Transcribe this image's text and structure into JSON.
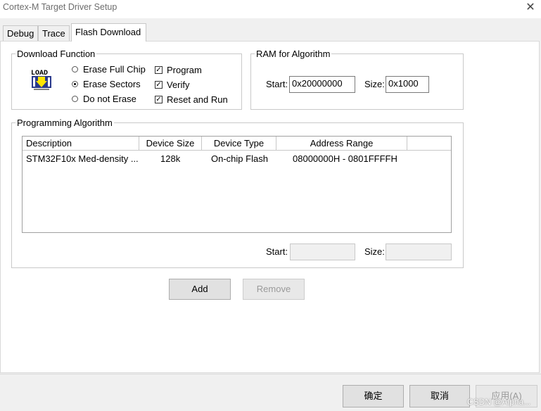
{
  "window": {
    "title": "Cortex-M Target Driver Setup",
    "close_glyph": "✕"
  },
  "tabs": [
    {
      "label": "Debug",
      "active": false
    },
    {
      "label": "Trace",
      "active": false
    },
    {
      "label": "Flash Download",
      "active": true
    }
  ],
  "download_function": {
    "group_title": "Download Function",
    "icon_label": "LOAD",
    "radios": [
      {
        "label": "Erase Full Chip",
        "selected": false
      },
      {
        "label": "Erase Sectors",
        "selected": true
      },
      {
        "label": "Do not Erase",
        "selected": false
      }
    ],
    "checks": [
      {
        "label": "Program",
        "checked": true
      },
      {
        "label": "Verify",
        "checked": true
      },
      {
        "label": "Reset and Run",
        "checked": true
      }
    ]
  },
  "ram": {
    "group_title": "RAM for Algorithm",
    "start_label": "Start:",
    "start_value": "0x20000000",
    "size_label": "Size:",
    "size_value": "0x1000"
  },
  "algorithm": {
    "group_title": "Programming Algorithm",
    "columns": [
      "Description",
      "Device Size",
      "Device Type",
      "Address Range"
    ],
    "rows": [
      {
        "description": "STM32F10x Med-density ...",
        "size": "128k",
        "type": "On-chip Flash",
        "range": "08000000H - 0801FFFFH"
      }
    ],
    "start_label": "Start:",
    "size_label": "Size:",
    "start_value": "",
    "size_value": ""
  },
  "buttons": {
    "add": "Add",
    "remove": "Remove"
  },
  "footer": {
    "ok": "确定",
    "cancel": "取消",
    "apply": "应用(A)"
  },
  "watermark": "CSDN @Alpha..."
}
